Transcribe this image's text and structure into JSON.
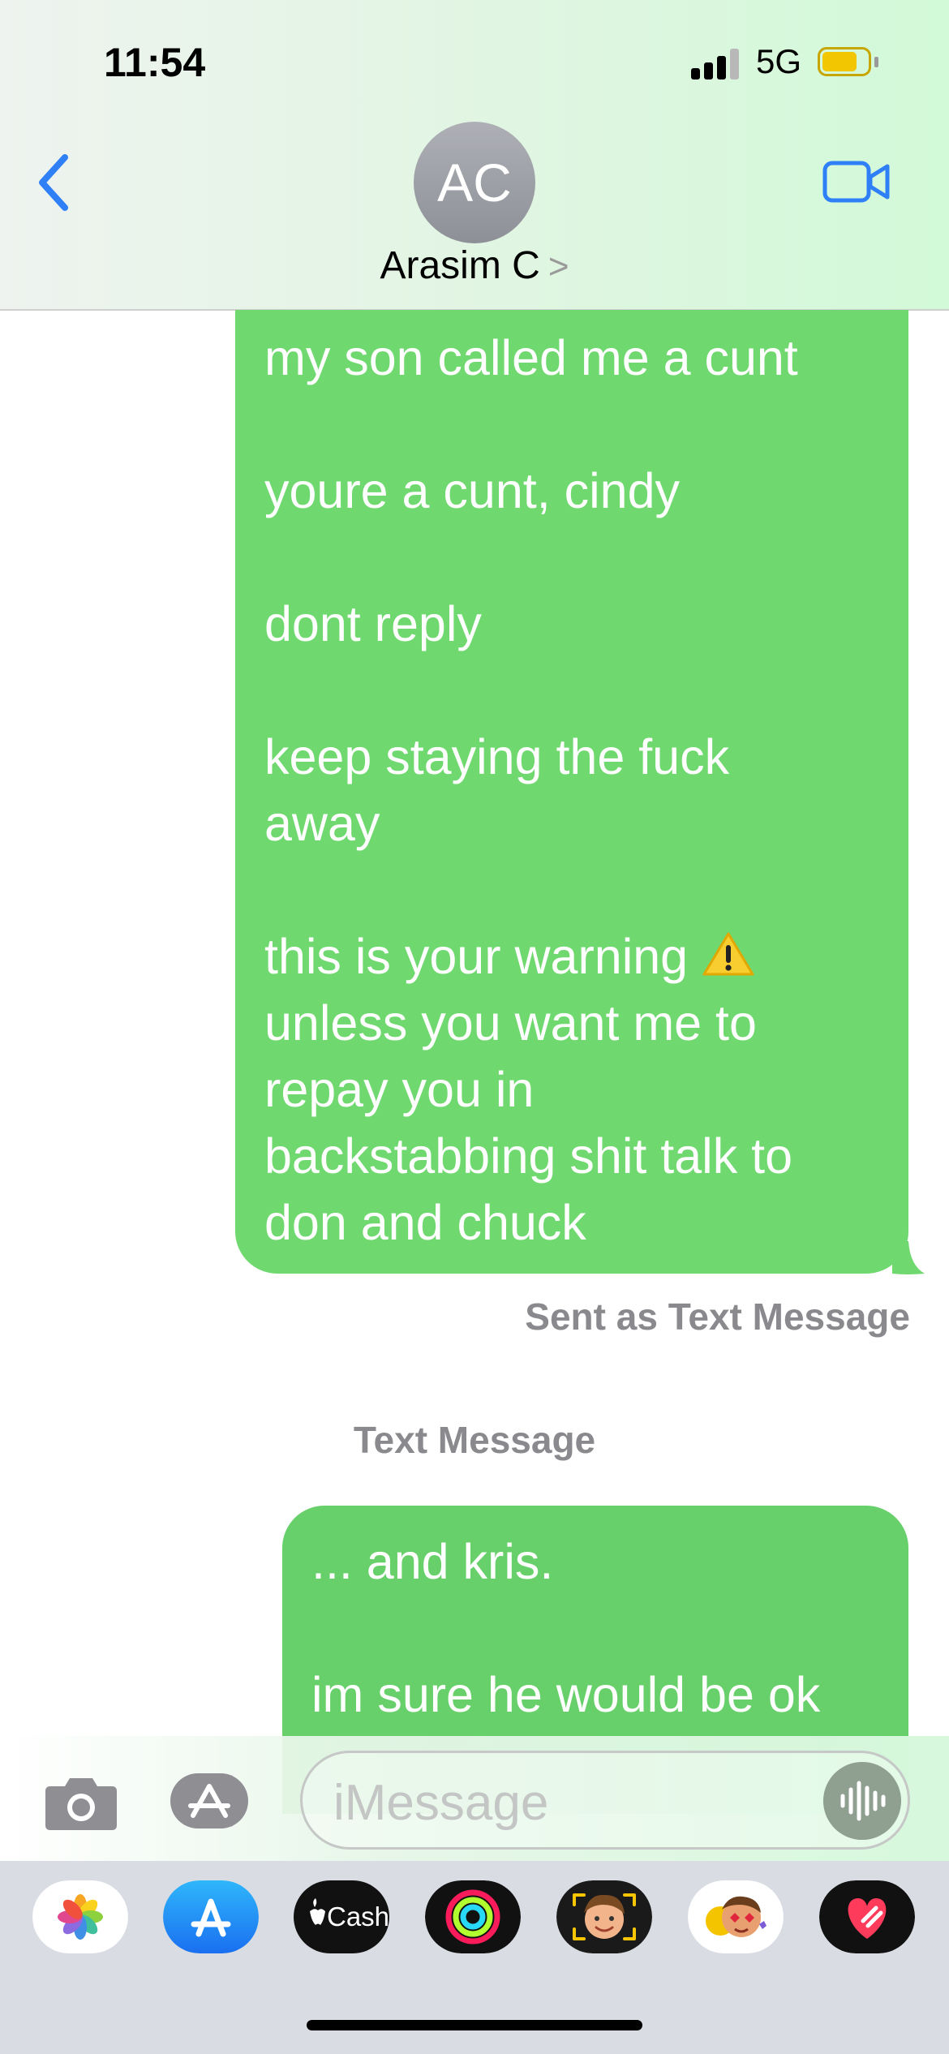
{
  "status_bar": {
    "time": "11:54",
    "network": "5G"
  },
  "header": {
    "avatar_initials": "AC",
    "contact_name": "Arasim C",
    "chevron": ">"
  },
  "messages": [
    {
      "lines": [
        "my son called me a cunt",
        "",
        "youre a cunt, cindy",
        "",
        "dont reply",
        "",
        "keep staying the fuck",
        "away",
        "",
        "this is your warning",
        "unless you want me to",
        "repay you in",
        "backstabbing shit talk to",
        "don and chuck"
      ],
      "status": "Sent as Text Message"
    },
    {
      "section_label": "Text Message",
      "lines": [
        "... and kris.",
        "",
        "im sure he would be ok"
      ]
    }
  ],
  "composer": {
    "placeholder": "iMessage"
  },
  "app_tray": {
    "cash_label": "Cash",
    "items": [
      "photos-app",
      "app-store-app",
      "apple-cash-app",
      "fitness-app",
      "memoji-app",
      "animoji-stickers-app",
      "digital-touch-app"
    ]
  },
  "colors": {
    "bubble_green": "#6fd86f",
    "link_blue": "#2f7ff7",
    "header_tint": "#d2f9d8",
    "battery_yellow": "#f2c600",
    "label_gray": "#8a8a8e"
  }
}
